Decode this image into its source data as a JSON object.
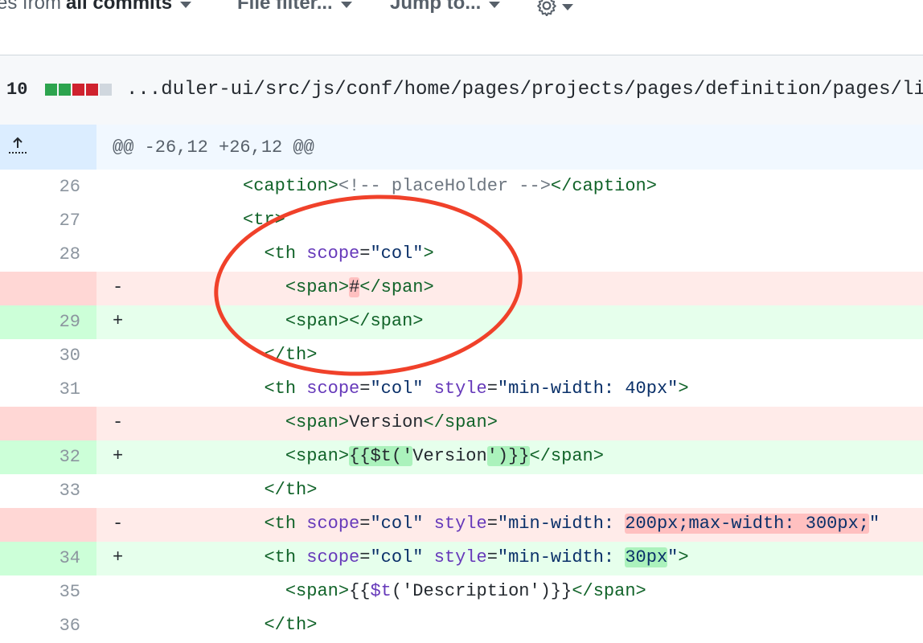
{
  "toolbar": {
    "changes_prefix": "es from",
    "changes_value": "all commits",
    "file_filter": "File filter...",
    "jump_to": "Jump to..."
  },
  "file": {
    "changes_count": "10",
    "diffstat": [
      "added",
      "added",
      "deleted",
      "deleted",
      "neutral"
    ],
    "path": "...duler-ui/src/js/conf/home/pages/projects/pages/definition/pages/li"
  },
  "hunk": {
    "header": "@@ -26,12 +26,12 @@"
  },
  "diff_lines": [
    {
      "type": "ctx",
      "ln": "26",
      "sign": ""
    },
    {
      "type": "ctx",
      "ln": "27",
      "sign": ""
    },
    {
      "type": "ctx",
      "ln": "28",
      "sign": ""
    },
    {
      "type": "del",
      "ln": "",
      "sign": "-"
    },
    {
      "type": "add",
      "ln": "29",
      "sign": "+"
    },
    {
      "type": "ctx",
      "ln": "30",
      "sign": ""
    },
    {
      "type": "ctx",
      "ln": "31",
      "sign": ""
    },
    {
      "type": "del",
      "ln": "",
      "sign": "-"
    },
    {
      "type": "add",
      "ln": "32",
      "sign": "+"
    },
    {
      "type": "ctx",
      "ln": "33",
      "sign": ""
    },
    {
      "type": "del",
      "ln": "",
      "sign": "-"
    },
    {
      "type": "add",
      "ln": "34",
      "sign": "+"
    },
    {
      "type": "ctx",
      "ln": "35",
      "sign": ""
    },
    {
      "type": "ctx",
      "ln": "36",
      "sign": ""
    }
  ],
  "code": {
    "l0": {
      "i": "          ",
      "a": "<",
      "b": "caption",
      "c": ">",
      "d": "<!-- placeHolder -->",
      "e": "</",
      "f": "caption",
      "g": ">"
    },
    "l1": {
      "i": "          ",
      "a": "<",
      "b": "tr",
      "c": ">"
    },
    "l2": {
      "i": "            ",
      "a": "<",
      "b": "th",
      "sp": " ",
      "at": "scope",
      "eq": "=",
      "v": "\"col\"",
      "c": ">"
    },
    "l3": {
      "i": "              ",
      "a": "<",
      "b": "span",
      "c": ">",
      "hl": "#",
      "e": "</",
      "f": "span",
      "g": ">"
    },
    "l4": {
      "i": "              ",
      "a": "<",
      "b": "span",
      "c": ">",
      "e": "</",
      "f": "span",
      "g": ">"
    },
    "l5": {
      "i": "            ",
      "a": "</",
      "b": "th",
      "c": ">"
    },
    "l6": {
      "i": "            ",
      "a": "<",
      "b": "th",
      "sp": " ",
      "at": "scope",
      "eq": "=",
      "v": "\"col\"",
      "sp2": " ",
      "at2": "style",
      "eq2": "=",
      "v2a": "\"",
      "v2b": "min-width: 40px",
      "v2c": "\"",
      "c": ">"
    },
    "l7": {
      "i": "              ",
      "a": "<",
      "b": "span",
      "c": ">",
      "t": "Version",
      "e": "</",
      "f": "span",
      "g": ">"
    },
    "l8": {
      "i": "              ",
      "a": "<",
      "b": "span",
      "c": ">",
      "h1": "{{$t('",
      "t": "Version",
      "h2": "')}}",
      "e": "</",
      "f": "span",
      "g": ">"
    },
    "l9": {
      "i": "            ",
      "a": "</",
      "b": "th",
      "c": ">"
    },
    "l10": {
      "i": "            ",
      "a": "<",
      "b": "th",
      "sp": " ",
      "at": "scope",
      "eq": "=",
      "v": "\"col\"",
      "sp2": " ",
      "at2": "style",
      "eq2": "=",
      "v2a": "\"min-width: ",
      "hl": "200px;max-width: 300px;",
      "v2c": "\""
    },
    "l11": {
      "i": "            ",
      "a": "<",
      "b": "th",
      "sp": " ",
      "at": "scope",
      "eq": "=",
      "v": "\"col\"",
      "sp2": " ",
      "at2": "style",
      "eq2": "=",
      "v2a": "\"min-width: ",
      "hl": "30px",
      "v2c": "\"",
      "c": ">"
    },
    "l12": {
      "i": "              ",
      "a": "<",
      "b": "span",
      "c": ">",
      "t1": "{{",
      "t2": "$t",
      "t3": "('Description')}}",
      "e": "</",
      "f": "span",
      "g": ">"
    },
    "l13": {
      "i": "            ",
      "a": "</",
      "b": "th",
      "c": ">"
    }
  },
  "colors": {
    "added": "#2da44e",
    "deleted": "#cf222e",
    "neutral": "#d0d7de",
    "annotation": "#f0412a"
  }
}
